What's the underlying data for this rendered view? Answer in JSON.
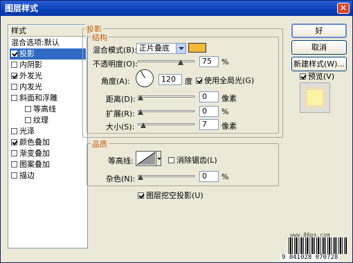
{
  "window": {
    "title": "图层样式",
    "close_label": "×"
  },
  "sidebar": {
    "header": "样式",
    "items": [
      {
        "label": "混合选项:默认",
        "checked": null
      },
      {
        "label": "投影",
        "checked": true,
        "selected": true
      },
      {
        "label": "内阴影",
        "checked": false
      },
      {
        "label": "外发光",
        "checked": true
      },
      {
        "label": "内发光",
        "checked": false
      },
      {
        "label": "斜面和浮雕",
        "checked": false
      },
      {
        "label": "等高线",
        "checked": false,
        "sub": true
      },
      {
        "label": "纹理",
        "checked": false,
        "sub": true
      },
      {
        "label": "光泽",
        "checked": false
      },
      {
        "label": "颜色叠加",
        "checked": true
      },
      {
        "label": "渐变叠加",
        "checked": false
      },
      {
        "label": "图案叠加",
        "checked": false
      },
      {
        "label": "描边",
        "checked": false
      }
    ]
  },
  "drop_shadow": {
    "section_title": "投影",
    "structure_title": "结构",
    "blend_mode_label": "混合模式(B):",
    "blend_mode_value": "正片叠底",
    "shadow_color": "#f5b83a",
    "opacity_label": "不透明度(O):",
    "opacity_value": "75",
    "percent": "%",
    "angle_label": "角度(A):",
    "angle_value": "120",
    "degree_unit": "度",
    "use_global_light_label": "使用全局光(G)",
    "use_global_light_checked": true,
    "distance_label": "距离(D):",
    "distance_value": "0",
    "spread_label": "扩展(R):",
    "spread_value": "0",
    "size_label": "大小(S):",
    "size_value": "7",
    "pixel_unit": "像素",
    "quality_title": "品质",
    "contour_label": "等高线:",
    "anti_alias_label": "消除锯齿(L)",
    "anti_alias_checked": false,
    "noise_label": "杂色(N):",
    "noise_value": "0",
    "knockout_label": "图层挖空投影(U)",
    "knockout_checked": true
  },
  "buttons": {
    "ok": "好",
    "cancel": "取消",
    "new_style": "新建样式(W)...",
    "preview_label": "预览(V)",
    "preview_checked": true
  },
  "watermark": {
    "site": "www.86ps.com",
    "barcode_number": "9 041028 070728"
  }
}
